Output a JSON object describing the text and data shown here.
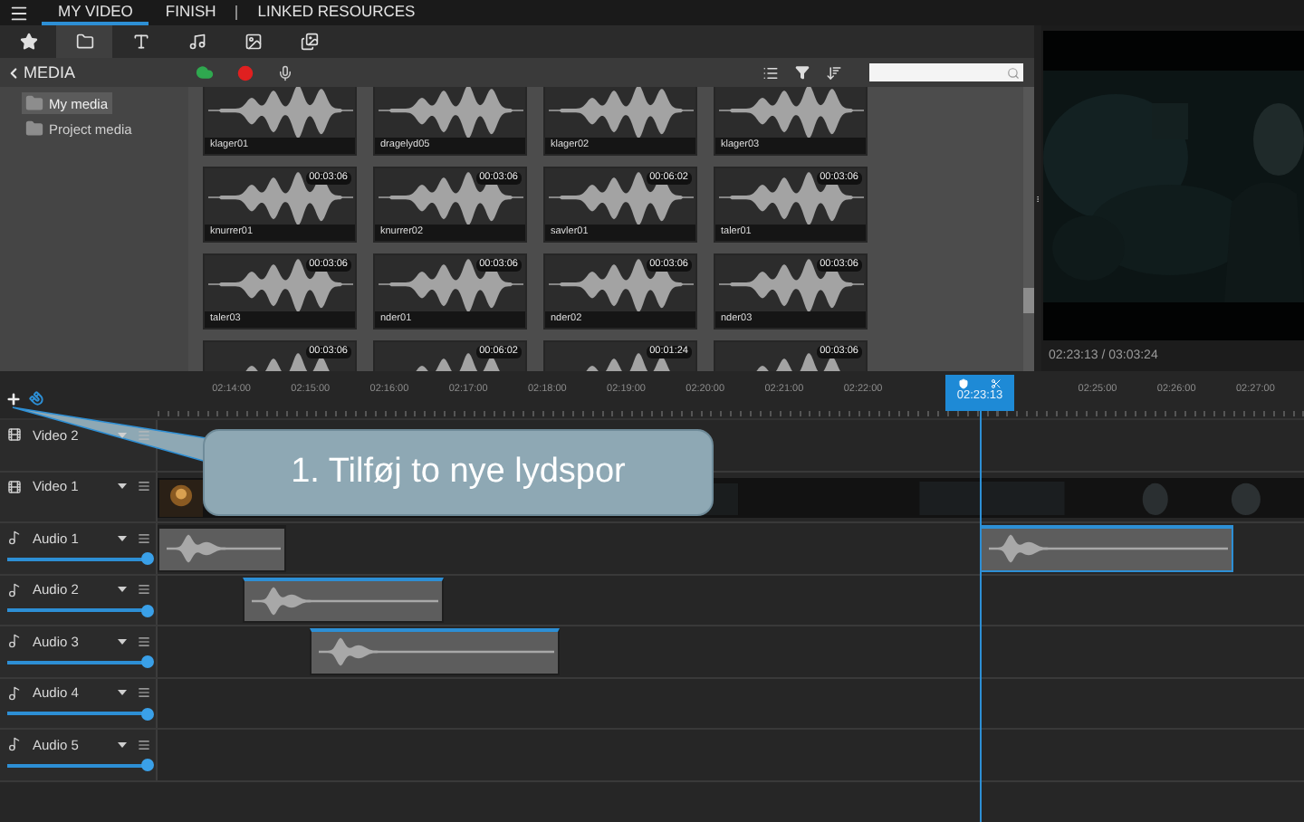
{
  "menu": {
    "tabs": [
      {
        "label": "MY VIDEO",
        "selected": true
      },
      {
        "label": "FINISH",
        "selected": false
      },
      {
        "label": "LINKED RESOURCES",
        "selected": false
      }
    ]
  },
  "library_tabs": [
    {
      "kind": "favorites",
      "selected": false
    },
    {
      "kind": "media",
      "selected": true
    },
    {
      "kind": "titles",
      "selected": false
    },
    {
      "kind": "audio",
      "selected": false
    },
    {
      "kind": "images",
      "selected": false
    },
    {
      "kind": "gallery",
      "selected": false
    }
  ],
  "media": {
    "title": "MEDIA",
    "folders": [
      {
        "label": "My media",
        "selected": true
      },
      {
        "label": "Project media",
        "selected": false
      }
    ],
    "items": [
      {
        "name": "klager01"
      },
      {
        "name": "dragelyd05"
      },
      {
        "name": "klager02"
      },
      {
        "name": "klager03"
      },
      {
        "name": "knurrer01",
        "duration": "00:03:06"
      },
      {
        "name": "knurrer02",
        "duration": "00:03:06"
      },
      {
        "name": "savler01",
        "duration": "00:06:02"
      },
      {
        "name": "taler01",
        "duration": "00:03:06"
      },
      {
        "name": "taler03",
        "duration": "00:03:06"
      },
      {
        "name": "nder01",
        "duration": "00:03:06"
      },
      {
        "name": "nder02",
        "duration": "00:03:06"
      },
      {
        "name": "nder03",
        "duration": "00:03:06"
      },
      {
        "duration": "00:03:06"
      },
      {
        "duration": "00:06:02"
      },
      {
        "duration": "00:01:24"
      },
      {
        "duration": "00:03:06"
      }
    ]
  },
  "preview": {
    "timecode": "02:23:13 / 03:03:24"
  },
  "timeline": {
    "playhead": "02:23:13",
    "ruler": {
      "labels_left": [
        "02:14:00",
        "02:15:00",
        "02:16:00",
        "02:17:00",
        "02:18:00",
        "02:19:00",
        "02:20:00",
        "02:21:00",
        "02:22:00"
      ],
      "labels_right": [
        "02:25:00",
        "02:26:00",
        "02:27:00"
      ]
    },
    "tracks": [
      {
        "kind": "video",
        "name": "Video 2"
      },
      {
        "kind": "video",
        "name": "Video 1"
      },
      {
        "kind": "audio",
        "name": "Audio 1",
        "level": 1
      },
      {
        "kind": "audio",
        "name": "Audio 2",
        "level": 1
      },
      {
        "kind": "audio",
        "name": "Audio 3",
        "level": 1
      },
      {
        "kind": "audio",
        "name": "Audio 4",
        "level": 1
      },
      {
        "kind": "audio",
        "name": "Audio 5",
        "level": 1
      }
    ]
  },
  "callout": {
    "text": "1. Tilføj to nye lydspor"
  }
}
